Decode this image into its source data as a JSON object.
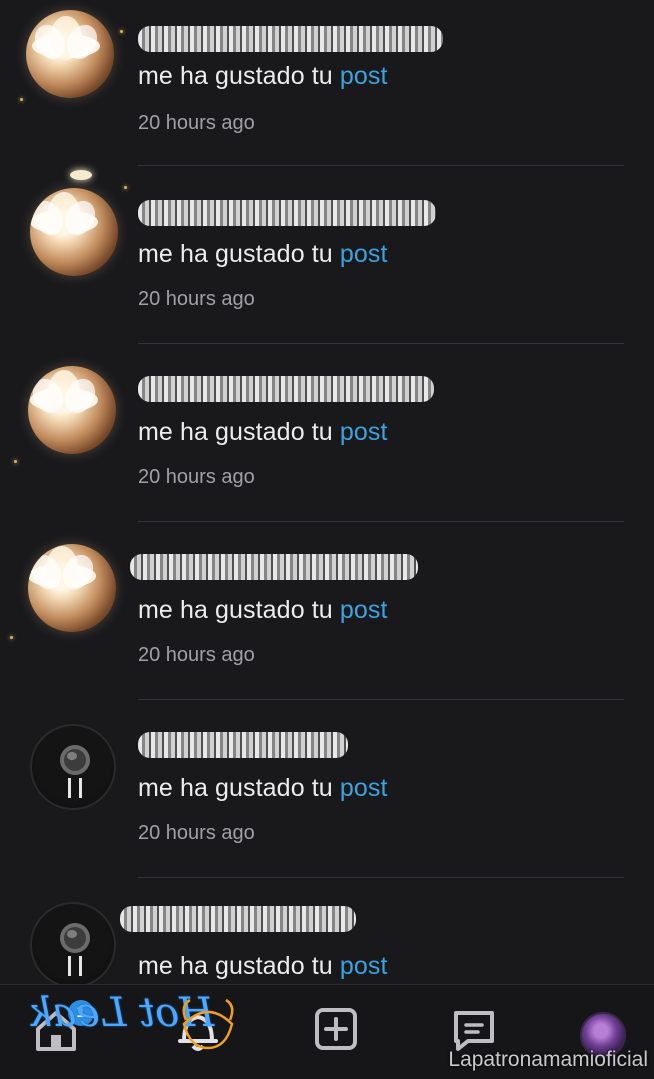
{
  "notifications": [
    {
      "avatar": "lotus-flower-avatar",
      "message": "me ha gustado tu",
      "link": "post",
      "time": "20 hours ago"
    },
    {
      "avatar": "lotus-flower-avatar",
      "message": "me ha gustado tu",
      "link": "post",
      "time": "20 hours ago"
    },
    {
      "avatar": "lotus-flower-avatar",
      "message": "me ha gustado tu",
      "link": "post",
      "time": "20 hours ago"
    },
    {
      "avatar": "lotus-flower-avatar",
      "message": "me ha gustado tu",
      "link": "post",
      "time": "20 hours ago"
    },
    {
      "avatar": "microphone-avatar",
      "message": "me ha gustado tu",
      "link": "post",
      "time": "20 hours ago"
    },
    {
      "avatar": "microphone-avatar",
      "message": "me ha gustado tu",
      "link": "post",
      "time": ""
    }
  ],
  "navbar": {
    "items": [
      "home-icon",
      "bell-icon",
      "add-post-icon",
      "messages-icon",
      "profile-avatar"
    ],
    "badge_count": "1"
  },
  "overlay": {
    "hotleak_text": "Hot Leak",
    "watermark": "Lapatronamamioficial"
  },
  "colors": {
    "background": "#19191c",
    "link": "#3aa3e0",
    "badge": "#2e8fe0",
    "hotleak": "#4aa8ff"
  }
}
